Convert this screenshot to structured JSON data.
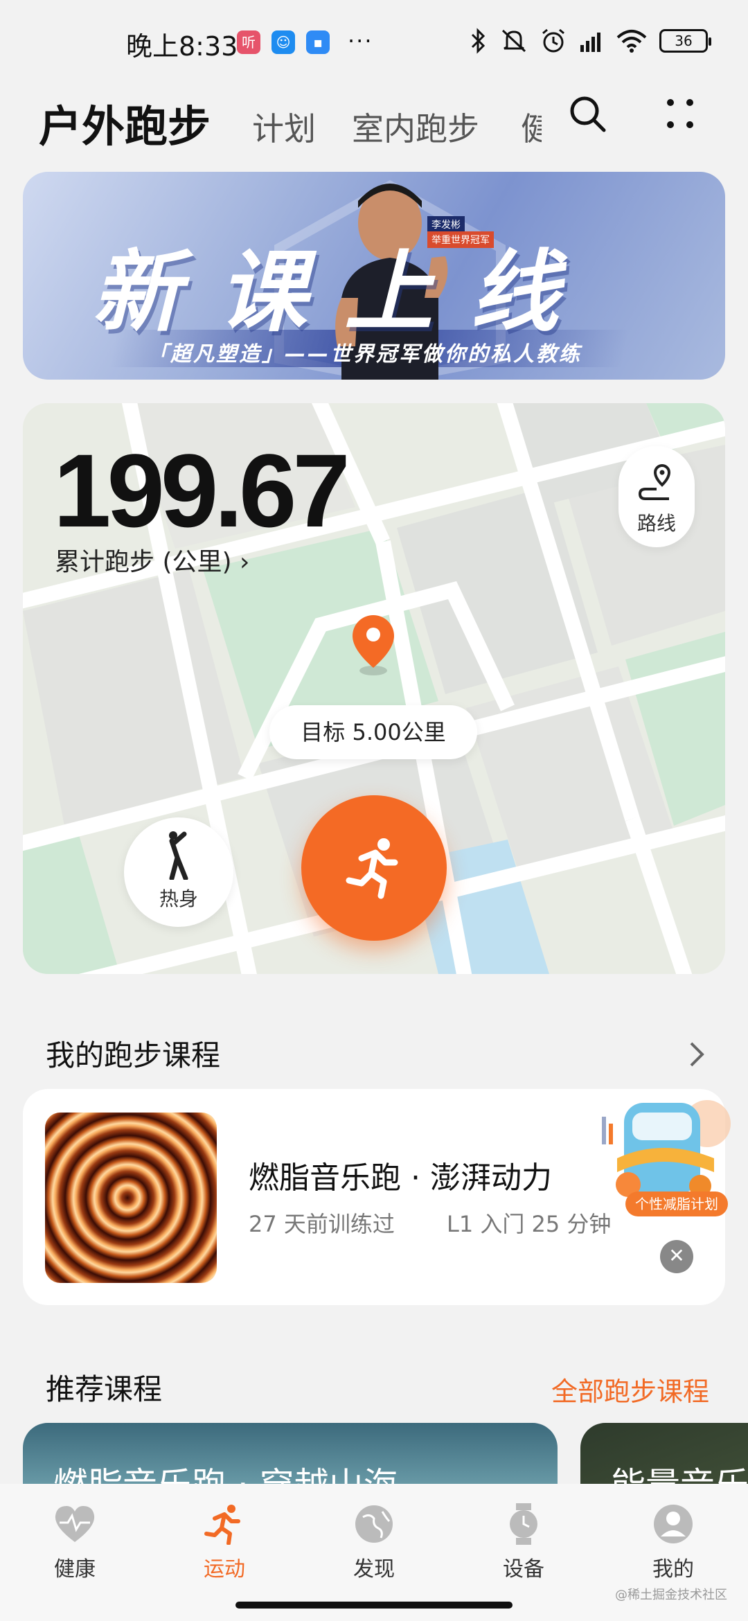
{
  "status_bar": {
    "time": "晚上8:33",
    "app_icon_1": "听",
    "dots": "···",
    "battery": "36",
    "icons": [
      "bluetooth-icon",
      "mute-icon",
      "alarm-icon",
      "signal-icon",
      "wifi-icon",
      "battery-icon"
    ]
  },
  "header": {
    "active_tab": "户外跑步",
    "tabs": [
      "计划",
      "室内跑步",
      "健"
    ],
    "icons": [
      "search-icon",
      "more-icon"
    ]
  },
  "banner": {
    "title": "新课上线",
    "subtitle": "「超凡塑造」——世界冠军做你的私人教练",
    "badge_name": "李发彬",
    "badge_title": "举重世界冠军"
  },
  "map_card": {
    "total_distance": "199.67",
    "total_label": "累计跑步 (公里)",
    "route_label": "路线",
    "goal": "目标 5.00公里",
    "warmup_label": "热身"
  },
  "my_courses": {
    "title": "我的跑步课程",
    "course_name": "燃脂音乐跑 · 澎湃动力",
    "course_last": "27 天前训练过",
    "course_level": "L1 入门 25 分钟",
    "promo_label": "个性减脂计划"
  },
  "recommended": {
    "title": "推荐课程",
    "all_link": "全部跑步课程",
    "cards": [
      "燃脂音乐跑 · 穿越山海",
      "能量音乐"
    ]
  },
  "bottom_nav": {
    "items": [
      "健康",
      "运动",
      "发现",
      "设备",
      "我的"
    ],
    "active": "运动"
  },
  "watermark": "@稀土掘金技术社区",
  "colors": {
    "accent": "#f26a25",
    "map_green": "#cfe8d5",
    "map_blue": "#bfe0f1"
  }
}
